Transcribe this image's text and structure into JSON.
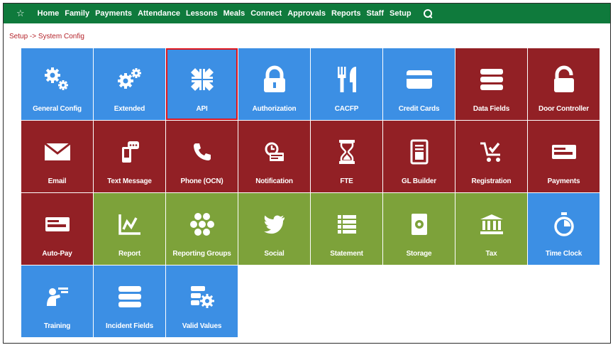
{
  "nav": {
    "items": [
      "Home",
      "Family",
      "Payments",
      "Attendance",
      "Lessons",
      "Meals",
      "Connect",
      "Approvals",
      "Reports",
      "Staff",
      "Setup"
    ],
    "favorite_icon": "star-icon",
    "search_icon": "search-icon"
  },
  "breadcrumb": {
    "text": "Setup -> System Config"
  },
  "colors": {
    "nav": "#0f7a3c",
    "blue": "#3c8fe4",
    "red": "#922025",
    "green": "#7da23a",
    "highlight": "#e0141b",
    "breadcrumb": "#b4232a"
  },
  "tiles": [
    {
      "label": "General Config",
      "icon": "gears-icon",
      "color": "blue"
    },
    {
      "label": "Extended",
      "icon": "gears-icon",
      "color": "blue"
    },
    {
      "label": "API",
      "icon": "compress-icon",
      "color": "blue",
      "selected": true
    },
    {
      "label": "Authorization",
      "icon": "lock-icon",
      "color": "blue"
    },
    {
      "label": "CACFP",
      "icon": "utensils-icon",
      "color": "blue"
    },
    {
      "label": "Credit Cards",
      "icon": "credit-card-icon",
      "color": "blue"
    },
    {
      "label": "Data Fields",
      "icon": "bars-icon",
      "color": "red"
    },
    {
      "label": "Door Controller",
      "icon": "unlock-icon",
      "color": "red"
    },
    {
      "label": "Email",
      "icon": "envelope-icon",
      "color": "red"
    },
    {
      "label": "Text Message",
      "icon": "mobile-chat-icon",
      "color": "red"
    },
    {
      "label": "Phone (OCN)",
      "icon": "phone-icon",
      "color": "red"
    },
    {
      "label": "Notification",
      "icon": "notification-icon",
      "color": "red"
    },
    {
      "label": "FTE",
      "icon": "hourglass-icon",
      "color": "red"
    },
    {
      "label": "GL Builder",
      "icon": "invoice-icon",
      "color": "red"
    },
    {
      "label": "Registration",
      "icon": "cart-check-icon",
      "color": "red"
    },
    {
      "label": "Payments",
      "icon": "money-bill-icon",
      "color": "red"
    },
    {
      "label": "Auto-Pay",
      "icon": "money-bill-icon",
      "color": "red"
    },
    {
      "label": "Report",
      "icon": "line-chart-icon",
      "color": "green"
    },
    {
      "label": "Reporting Groups",
      "icon": "hexagons-icon",
      "color": "green"
    },
    {
      "label": "Social",
      "icon": "twitter-icon",
      "color": "green"
    },
    {
      "label": "Statement",
      "icon": "list-icon",
      "color": "green"
    },
    {
      "label": "Storage",
      "icon": "hdd-icon",
      "color": "green"
    },
    {
      "label": "Tax",
      "icon": "bank-icon",
      "color": "green"
    },
    {
      "label": "Time Clock",
      "icon": "stopwatch-icon",
      "color": "blue"
    },
    {
      "label": "Training",
      "icon": "trainer-icon",
      "color": "blue"
    },
    {
      "label": "Incident Fields",
      "icon": "bars-icon",
      "color": "blue"
    },
    {
      "label": "Valid Values",
      "icon": "list-gear-icon",
      "color": "blue"
    }
  ]
}
